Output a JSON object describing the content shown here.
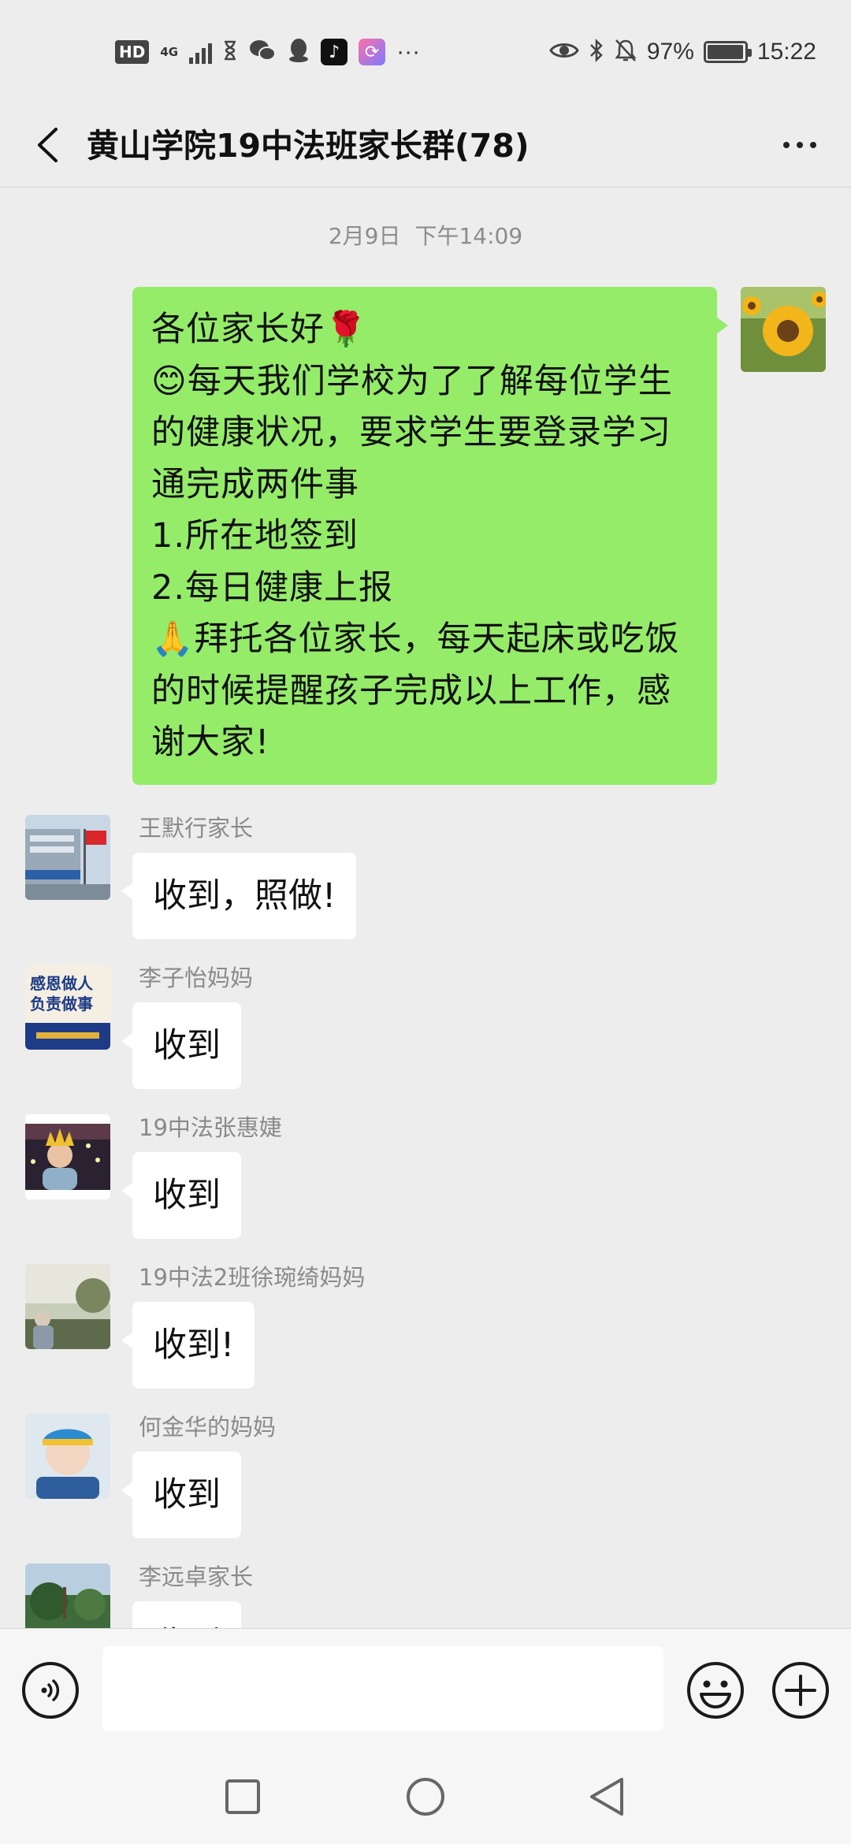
{
  "status_bar": {
    "hd": "HD",
    "network": "4G",
    "battery_percent": "97%",
    "battery_level": 0.97,
    "time": "15:22",
    "overflow": "···"
  },
  "header": {
    "title": "黄山学院19中法班家长群(78)"
  },
  "chat": {
    "timestamp_date": "2月9日",
    "timestamp_time": "下午14:09",
    "self_message": {
      "lines": [
        "各位家长好🌹",
        "😊每天我们学校为了了解每位学生",
        "的健康状况，要求学生要登录学习",
        "通完成两件事",
        "1.所在地签到",
        "2.每日健康上报",
        "🙏拜托各位家长，每天起床或吃饭",
        "的时候提醒孩子完成以上工作，感",
        "谢大家!"
      ]
    },
    "messages": [
      {
        "sender": "王默行家长",
        "text": "收到，照做!"
      },
      {
        "sender": "李子怡妈妈",
        "text": "收到"
      },
      {
        "sender": "19中法张惠婕",
        "text": "收到"
      },
      {
        "sender": "19中法2班徐琬绮妈妈",
        "text": "收到!"
      },
      {
        "sender": "何金华的妈妈",
        "text": "收到"
      },
      {
        "sender": "李远卓家长",
        "text": "收到"
      }
    ],
    "avatar_texts": {
      "li_ziyi": [
        "感恩做人",
        "负责做事"
      ]
    }
  },
  "input": {
    "value": "",
    "placeholder": ""
  },
  "colors": {
    "background": "#ededed",
    "self_bubble": "#95ec69",
    "other_bubble": "#ffffff",
    "sender_name": "#8a8a8a"
  },
  "icons": {
    "back": "chevron-left-icon",
    "more": "more-dots-icon",
    "voice": "voice-icon",
    "emoji": "emoji-icon",
    "plus": "plus-icon",
    "nav_recent": "square-icon",
    "nav_home": "circle-icon",
    "nav_back": "triangle-icon"
  }
}
